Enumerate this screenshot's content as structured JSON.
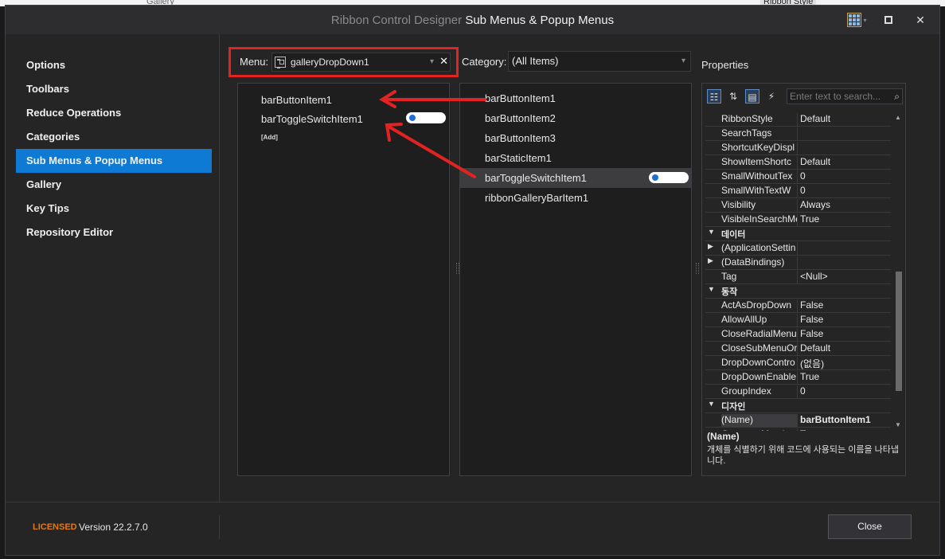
{
  "background": {
    "left_text": "Gallery",
    "right_text": "Ribbon Style"
  },
  "window": {
    "title_prefix": "Ribbon Control Designer",
    "title_main": "Sub Menus & Popup Menus"
  },
  "nav": {
    "items": [
      {
        "label": "Options",
        "active": false
      },
      {
        "label": "Toolbars",
        "active": false
      },
      {
        "label": "Reduce Operations",
        "active": false
      },
      {
        "label": "Categories",
        "active": false
      },
      {
        "label": "Sub Menus & Popup Menus",
        "active": true
      },
      {
        "label": "Gallery",
        "active": false
      },
      {
        "label": "Key Tips",
        "active": false
      },
      {
        "label": "Repository Editor",
        "active": false
      }
    ]
  },
  "menu": {
    "label": "Menu:",
    "value": "galleryDropDown1",
    "clear": "✕",
    "arrow": "▾"
  },
  "category": {
    "label": "Category:",
    "value": "(All Items)",
    "arrow": "▾"
  },
  "left_list": {
    "items": [
      "barButtonItem1",
      "barToggleSwitchItem1"
    ],
    "add_label": "[Add]"
  },
  "mid_list": {
    "items": [
      "barButtonItem1",
      "barButtonItem2",
      "barButtonItem3",
      "barStaticItem1",
      "barToggleSwitchItem1",
      "ribbonGalleryBarItem1"
    ],
    "selected": "barToggleSwitchItem1"
  },
  "properties": {
    "title": "Properties",
    "search_placeholder": "Enter text to search...",
    "rows": [
      {
        "type": "prop",
        "name": "RibbonStyle",
        "value": "Default"
      },
      {
        "type": "prop",
        "name": "SearchTags",
        "value": ""
      },
      {
        "type": "prop",
        "name": "ShortcutKeyDispl",
        "value": ""
      },
      {
        "type": "prop",
        "name": "ShowItemShortc",
        "value": "Default"
      },
      {
        "type": "prop",
        "name": "SmallWithoutTex",
        "value": "0"
      },
      {
        "type": "prop",
        "name": "SmallWithTextW",
        "value": "0"
      },
      {
        "type": "prop",
        "name": "Visibility",
        "value": "Always"
      },
      {
        "type": "prop",
        "name": "VisibleInSearchMe",
        "value": "True"
      },
      {
        "type": "cat",
        "name": "데이터"
      },
      {
        "type": "expand",
        "name": "(ApplicationSettin",
        "value": ""
      },
      {
        "type": "expand",
        "name": "(DataBindings)",
        "value": ""
      },
      {
        "type": "prop",
        "name": "Tag",
        "value": "<Null>"
      },
      {
        "type": "cat",
        "name": "동작"
      },
      {
        "type": "prop",
        "name": "ActAsDropDown",
        "value": "False"
      },
      {
        "type": "prop",
        "name": "AllowAllUp",
        "value": "False"
      },
      {
        "type": "prop",
        "name": "CloseRadialMenuC",
        "value": "False"
      },
      {
        "type": "prop",
        "name": "CloseSubMenuOr",
        "value": "Default"
      },
      {
        "type": "prop",
        "name": "DropDownContro",
        "value": "(없음)"
      },
      {
        "type": "prop",
        "name": "DropDownEnable",
        "value": "True"
      },
      {
        "type": "prop",
        "name": "GroupIndex",
        "value": "0"
      },
      {
        "type": "cat",
        "name": "디자인"
      },
      {
        "type": "sel",
        "name": "(Name)",
        "value": "barButtonItem1"
      },
      {
        "type": "prop",
        "name": "GenerateMemb",
        "value": "True"
      }
    ],
    "desc_title": "(Name)",
    "desc_text": "개체를 식별하기 위해 코드에 사용되는 이름을 나타냅니다."
  },
  "footer": {
    "licensed": "LICENSED",
    "version": "Version 22.2.7.0",
    "close_label": "Close"
  },
  "colors": {
    "accent": "#0e7ad4",
    "annotation": "#e32222",
    "licensed": "#e37a16"
  }
}
